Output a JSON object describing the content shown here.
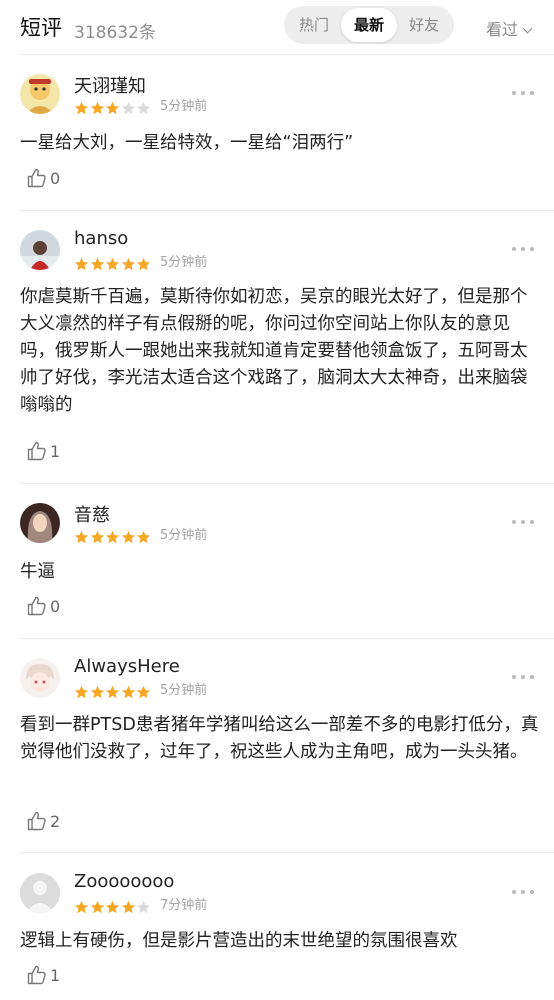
{
  "header": {
    "title": "短评",
    "count": "318632条",
    "tabs": [
      "热门",
      "最新",
      "好友"
    ],
    "sort_label": "看过"
  },
  "colors": {
    "star_filled": "#f5a623",
    "star_empty": "#dadada"
  },
  "reviews": [
    {
      "user": "天诩瑾知",
      "rating": 3,
      "time": "5分钟前",
      "text": "一星给大刘，一星给特效，一星给“泪两行”",
      "likes": "0",
      "avatar_icon": "cartoon-avatar-icon"
    },
    {
      "user": "hanso",
      "rating": 5,
      "time": "5分钟前",
      "text": "你虐莫斯千百遍，莫斯待你如初恋，吴京的眼光太好了，但是那个大义凛然的样子有点假掰的呢，你问过你空间站上你队友的意见吗，俄罗斯人一跟她出来我就知道肯定要替他领盒饭了，五阿哥太帅了好伐，李光洁太适合这个戏路了，脑洞太大太神奇，出来脑袋嗡嗡的",
      "likes": "1",
      "avatar_icon": "photo-avatar-icon"
    },
    {
      "user": "音慈",
      "rating": 5,
      "time": "5分钟前",
      "text": "牛逼",
      "likes": "0",
      "avatar_icon": "photo-avatar-icon"
    },
    {
      "user": "AlwaysHere",
      "rating": 5,
      "time": "5分钟前",
      "text": "看到一群PTSD患者猪年学猪叫给这么一部差不多的电影打低分，真觉得他们没救了，过年了，祝这些人成为主角吧，成为一头头猪。",
      "likes": "2",
      "avatar_icon": "anime-avatar-icon"
    },
    {
      "user": "Zoooooooo",
      "rating": 4,
      "time": "7分钟前",
      "text": "逻辑上有硬伤，但是影片营造出的末世绝望的氛围很喜欢",
      "likes": "1",
      "avatar_icon": "default-avatar-icon"
    }
  ]
}
